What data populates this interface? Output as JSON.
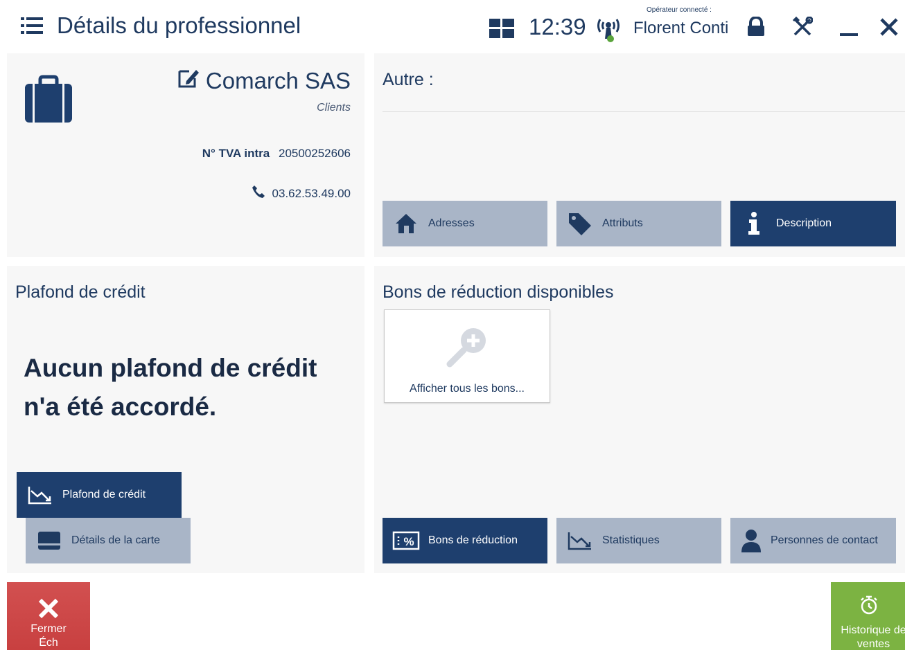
{
  "header": {
    "title": "Détails du professionnel",
    "time": "12:39",
    "operator_label": "Opérateur connecté :",
    "operator_name": "Florent Conti"
  },
  "customer": {
    "name": "Comarch SAS",
    "type": "Clients",
    "vat_label": "N° TVA intra",
    "vat_value": "20500252606",
    "phone": "03.62.53.49.00"
  },
  "other": {
    "title": "Autre :"
  },
  "top_tabs": [
    {
      "label": "Adresses",
      "icon": "home-icon",
      "active": false
    },
    {
      "label": "Attributs",
      "icon": "tag-icon",
      "active": false
    },
    {
      "label": "Description",
      "icon": "info-icon",
      "active": true
    }
  ],
  "credit": {
    "title": "Plafond de crédit",
    "message_line1": "Aucun plafond de crédit",
    "message_line2": "n'a été accordé."
  },
  "bottom_left_tabs": [
    {
      "label": "Plafond de crédit",
      "icon": "chart-down-icon",
      "active": true
    },
    {
      "label": "Détails de la carte",
      "icon": "card-icon",
      "active": false
    }
  ],
  "vouchers": {
    "title": "Bons de réduction disponibles",
    "show_all_label": "Afficher tous les bons..."
  },
  "bottom_right_tabs": [
    {
      "label": "Bons de réduction",
      "icon": "percent-icon",
      "active": true
    },
    {
      "label": "Statistiques",
      "icon": "chart-down-icon",
      "active": false
    },
    {
      "label": "Personnes de contact",
      "icon": "person-icon",
      "active": false
    }
  ],
  "footer": {
    "close_label_line1": "Fermer",
    "close_label_line2": "Éch",
    "history_label_line1": "Historique de",
    "history_label_line2": "ventes"
  },
  "colors": {
    "primary": "#1e3f6e",
    "tab_inactive": "#a9b5c7",
    "close_red": "#d25050",
    "history_green": "#7cb342"
  }
}
